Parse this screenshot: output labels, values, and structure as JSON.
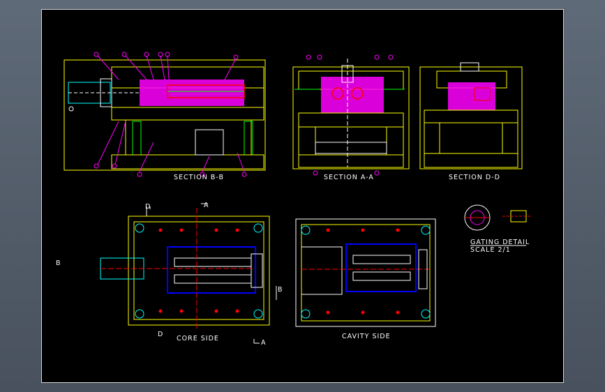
{
  "sheet": {
    "background": "#000000",
    "frame_color": "#ffffff"
  },
  "views": {
    "section_bb": {
      "title": "SECTION B-B"
    },
    "section_aa": {
      "title": "SECTION A-A"
    },
    "section_dd": {
      "title": "SECTION D-D"
    },
    "gating": {
      "title": "GATING DETAIL",
      "scale": "SCALE 2/1"
    },
    "core_side": {
      "title": "CORE SIDE",
      "cut_a": "A",
      "cut_b": "B",
      "cut_d": "D"
    },
    "cavity_side": {
      "title": "CAVITY SIDE"
    }
  },
  "colors": {
    "plate": "#ffff00",
    "cavity_fill": "#ff00ff",
    "section_line": "#ff0000",
    "part_green": "#00ff00",
    "water_blue": "#0000ff",
    "cyan": "#00ffff",
    "hatch": "#ff00ff",
    "dim_line": "#ffffff"
  }
}
